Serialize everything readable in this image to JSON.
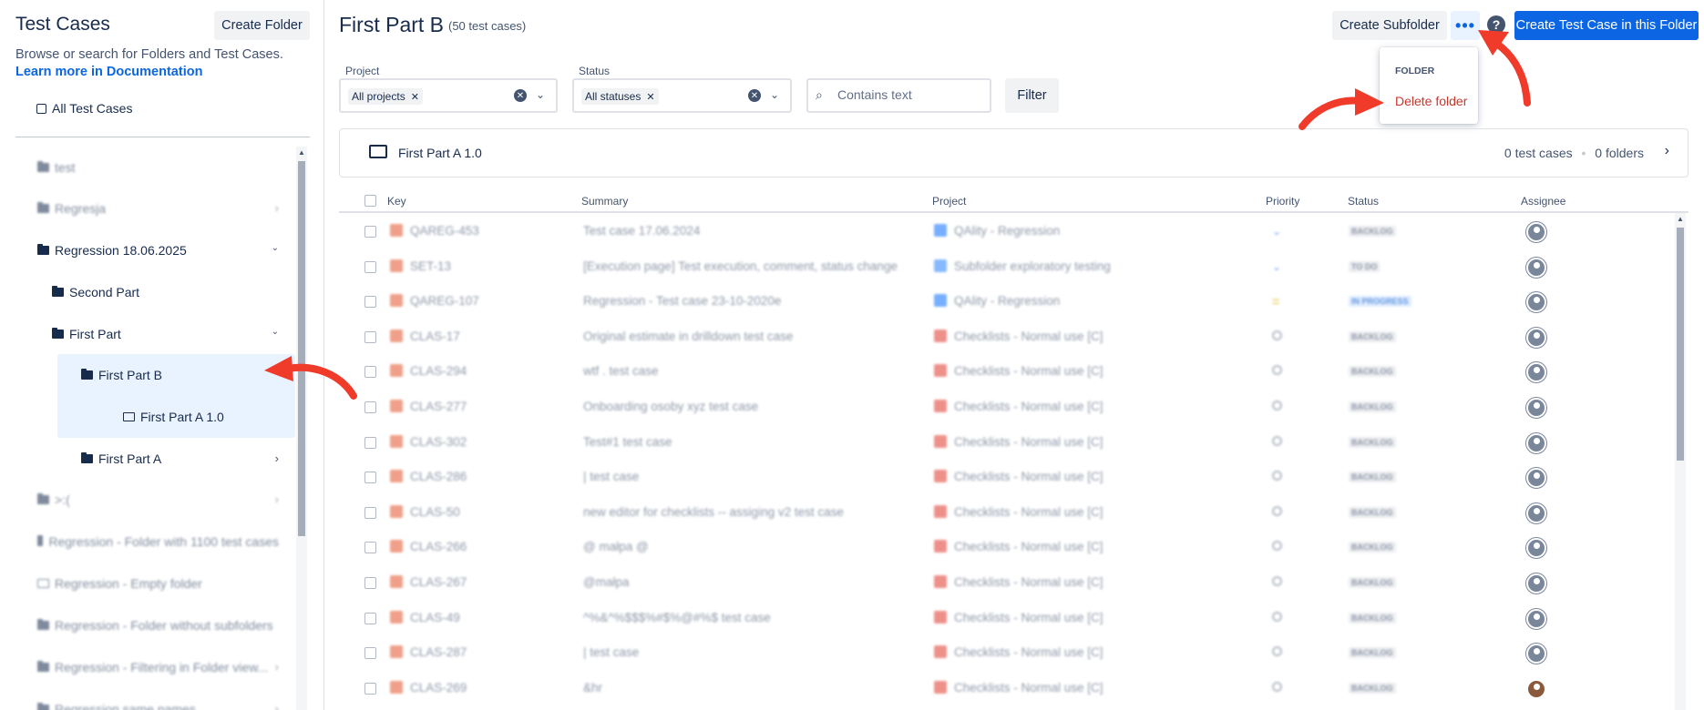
{
  "sidebar": {
    "title": "Test Cases",
    "create_folder": "Create Folder",
    "description": "Browse or search for Folders and Test Cases.",
    "doc_link": "Learn more in Documentation",
    "all_test_cases": "All Test Cases",
    "tree": [
      {
        "label": "test"
      },
      {
        "label": "Regresja"
      },
      {
        "label": "Regression 18.06.2025"
      },
      {
        "label": "Second Part"
      },
      {
        "label": "First Part"
      },
      {
        "label": "First Part B"
      },
      {
        "label": "First Part A 1.0"
      },
      {
        "label": "First Part A"
      },
      {
        "label": ">:("
      },
      {
        "label": "Regression - Folder with 1100 test cases"
      },
      {
        "label": "Regression - Empty folder"
      },
      {
        "label": "Regression - Folder without subfolders"
      },
      {
        "label": "Regression - Filtering in Folder view..."
      },
      {
        "label": "Regression same names"
      }
    ]
  },
  "header": {
    "title": "First Part B",
    "count": "(50 test cases)",
    "create_subfolder": "Create Subfolder",
    "more": "•••",
    "help": "?",
    "create_test_case": "Create Test Case in this Folder"
  },
  "dropdown": {
    "header": "FOLDER",
    "delete": "Delete folder"
  },
  "filters": {
    "project_label": "Project",
    "project_value": "All projects",
    "status_label": "Status",
    "status_value": "All statuses",
    "search_placeholder": "Contains text",
    "filter_button": "Filter"
  },
  "subfolder": {
    "name": "First Part A 1.0",
    "test_cases": "0 test cases",
    "sep": "•",
    "folders": "0 folders"
  },
  "table": {
    "headers": {
      "key": "Key",
      "summary": "Summary",
      "project": "Project",
      "priority": "Priority",
      "status": "Status",
      "assignee": "Assignee"
    },
    "rows": [
      {
        "key": "QAREG-453",
        "summary": "Test case 17.06.2024",
        "project": "QAlity - Regression",
        "priority": "low",
        "status": "BACKLOG"
      },
      {
        "key": "SET-13",
        "summary": "[Execution page] Test execution, comment, status change",
        "project": "Subfolder exploratory testing",
        "priority": "low",
        "status": "TO DO"
      },
      {
        "key": "QAREG-107",
        "summary": "Regression - Test case 23-10-2020e",
        "project": "QAlity - Regression",
        "priority": "medium",
        "status": "IN PROGRESS"
      },
      {
        "key": "CLAS-17",
        "summary": "Original estimate in drilldown test case",
        "project": "Checklists - Normal use [C]",
        "priority": "none",
        "status": "BACKLOG"
      },
      {
        "key": "CLAS-294",
        "summary": "wtf . test case",
        "project": "Checklists - Normal use [C]",
        "priority": "none",
        "status": "BACKLOG"
      },
      {
        "key": "CLAS-277",
        "summary": "Onboarding osoby xyz test case",
        "project": "Checklists - Normal use [C]",
        "priority": "none",
        "status": "BACKLOG"
      },
      {
        "key": "CLAS-302",
        "summary": "Test#1 test case",
        "project": "Checklists - Normal use [C]",
        "priority": "none",
        "status": "BACKLOG"
      },
      {
        "key": "CLAS-286",
        "summary": "| test case",
        "project": "Checklists - Normal use [C]",
        "priority": "none",
        "status": "BACKLOG"
      },
      {
        "key": "CLAS-50",
        "summary": "new editor for checklists -- assiging v2 test case",
        "project": "Checklists - Normal use [C]",
        "priority": "none",
        "status": "BACKLOG"
      },
      {
        "key": "CLAS-266",
        "summary": "@ małpa @",
        "project": "Checklists - Normal use [C]",
        "priority": "none",
        "status": "BACKLOG"
      },
      {
        "key": "CLAS-267",
        "summary": "@małpa",
        "project": "Checklists - Normal use [C]",
        "priority": "none",
        "status": "BACKLOG"
      },
      {
        "key": "CLAS-49",
        "summary": "^%&^%$$$%#$%@#%$ test case",
        "project": "Checklists - Normal use [C]",
        "priority": "none",
        "status": "BACKLOG"
      },
      {
        "key": "CLAS-287",
        "summary": "| test case",
        "project": "Checklists - Normal use [C]",
        "priority": "none",
        "status": "BACKLOG"
      },
      {
        "key": "CLAS-269",
        "summary": "&hr",
        "project": "Checklists - Normal use [C]",
        "priority": "none",
        "status": "BACKLOG"
      }
    ]
  },
  "colors": {
    "primary": "#0c66e4",
    "danger": "#c9372c",
    "arrow": "#f03a2a",
    "selected_bg": "#e9f2ff"
  }
}
